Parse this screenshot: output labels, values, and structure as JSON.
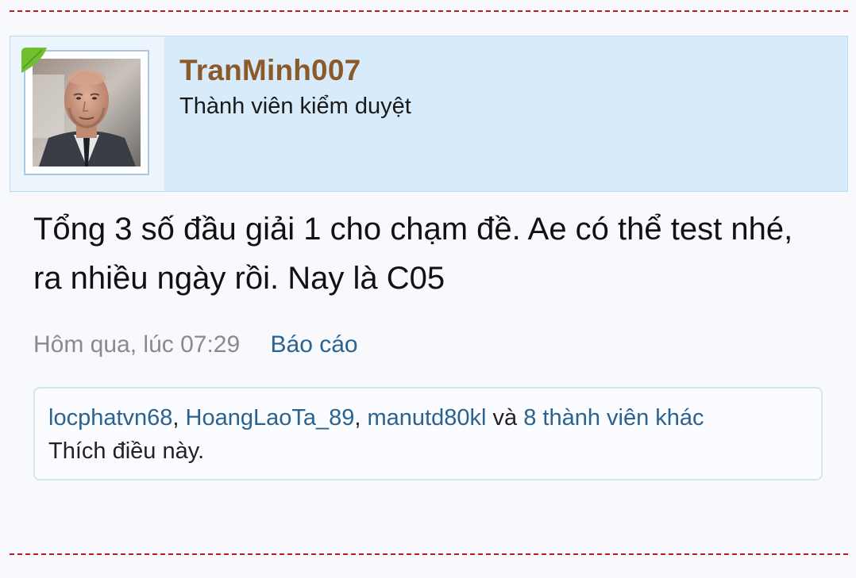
{
  "post": {
    "username": "TranMinh007",
    "user_title": "Thành viên kiểm duyệt",
    "message": "Tổng 3 số đầu giải 1 cho chạm đề. Ae có thể test nhé, ra nhiều ngày rồi. Nay là C05",
    "timestamp": "Hôm qua, lúc 07:29",
    "report_label": "Báo cáo"
  },
  "likes": {
    "users": [
      "locphatvn68",
      "HoangLaoTa_89",
      "manutd80kl"
    ],
    "separator": ", ",
    "conjunction": " và ",
    "others_label": "8 thành viên khác",
    "suffix": "Thích điều này."
  },
  "colors": {
    "username": "#8b5a2b",
    "link": "#2b6290",
    "header_bg": "#d8ebfa",
    "divider": "#b71c1c",
    "leaf_badge": "#6fbf2e"
  }
}
